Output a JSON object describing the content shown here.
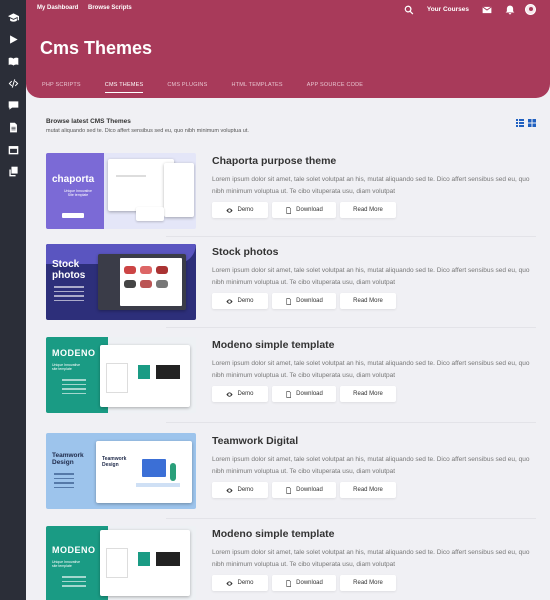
{
  "sidebar": {
    "icons": [
      "graduation-cap-icon",
      "play-icon",
      "book-icon",
      "code-icon",
      "comment-icon",
      "file-icon",
      "calendar-icon",
      "copy-icon"
    ]
  },
  "header": {
    "nav": [
      "My Dashboard",
      "Browse Scripts"
    ],
    "your_courses": "Your Courses",
    "title": "Cms Themes",
    "tabs": [
      {
        "label": "PHP SCRIPTS",
        "active": false
      },
      {
        "label": "CMS THEMES",
        "active": true
      },
      {
        "label": "CMS PLUGINS",
        "active": false
      },
      {
        "label": "HTML TEMPLATES",
        "active": false
      },
      {
        "label": "APP SOURCE CODE",
        "active": false
      }
    ],
    "accent_color": "#a83a5a"
  },
  "main": {
    "title": "Browse latest CMS Themes",
    "subtitle": "mutat aliquando sed te. Dico affert sensibus sed eu, quo nibh minimum voluptua ut.",
    "buttons": {
      "demo": "Demo",
      "download": "Download",
      "read_more": "Read More"
    },
    "items": [
      {
        "title": "Chaporta purpose theme",
        "description": "Lorem ipsum dolor sit amet, tale solet volutpat an his, mutat aliquando sed te. Dico affert sensibus sed eu, quo nibh minimum voluptua ut. Te cibo vituperata usu, diam volutpat",
        "thumb_text": "chaporta",
        "thumb_sub": "Unique Innovative\nSite template"
      },
      {
        "title": "Stock photos",
        "description": "Lorem ipsum dolor sit amet, tale solet volutpat an his, mutat aliquando sed te. Dico affert sensibus sed eu, quo nibh minimum voluptua ut. Te cibo vituperata usu, diam volutpat",
        "thumb_text": "Stock\nphotos"
      },
      {
        "title": "Modeno simple template",
        "description": "Lorem ipsum dolor sit amet, tale solet volutpat an his, mutat aliquando sed te. Dico affert sensibus sed eu, quo nibh minimum voluptua ut. Te cibo vituperata usu, diam volutpat",
        "thumb_text": "MODENO",
        "thumb_sub": "Unique Innovative\nsite template"
      },
      {
        "title": "Teamwork Digital",
        "description": "Lorem ipsum dolor sit amet, tale solet volutpat an his, mutat aliquando sed te. Dico affert sensibus sed eu, quo nibh minimum voluptua ut. Te cibo vituperata usu, diam volutpat",
        "thumb_text": "Teamwork\nDesign"
      },
      {
        "title": "Modeno simple template",
        "description": "Lorem ipsum dolor sit amet, tale solet volutpat an his, mutat aliquando sed te. Dico affert sensibus sed eu, quo nibh minimum voluptua ut. Te cibo vituperata usu, diam volutpat",
        "thumb_text": "MODENO",
        "thumb_sub": "Unique Innovative\nsite template"
      }
    ]
  }
}
